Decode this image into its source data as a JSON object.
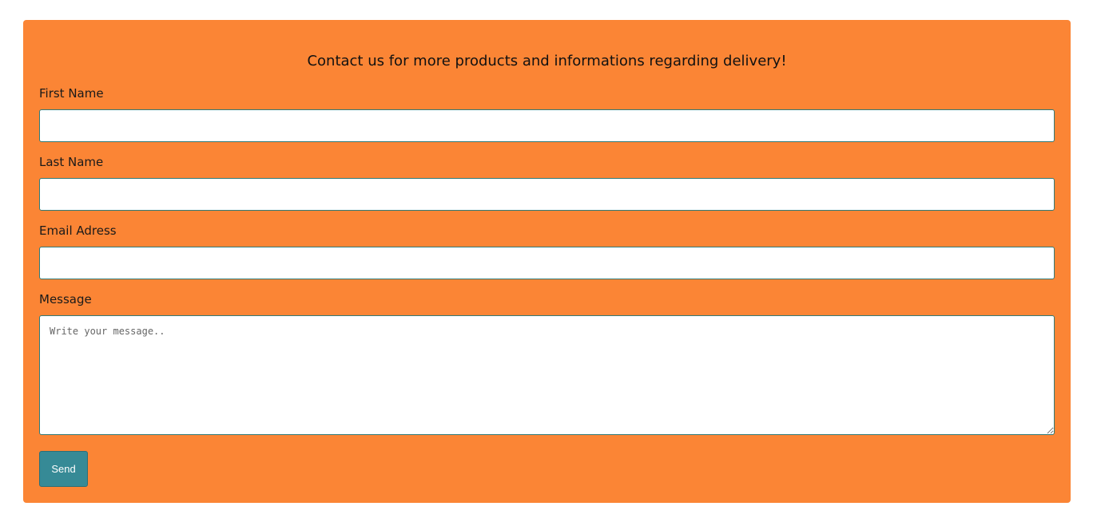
{
  "form": {
    "title": "Contact us for more products and informations regarding delivery!",
    "first_name_label": "First Name",
    "first_name_value": "",
    "last_name_label": "Last Name",
    "last_name_value": "",
    "email_label": "Email Adress",
    "email_value": "",
    "message_label": "Message",
    "message_placeholder": "Write your message..",
    "send_label": "Send"
  },
  "colors": {
    "card_background": "#fb8535",
    "button_background": "#368a96",
    "input_border": "#2f7a78"
  }
}
